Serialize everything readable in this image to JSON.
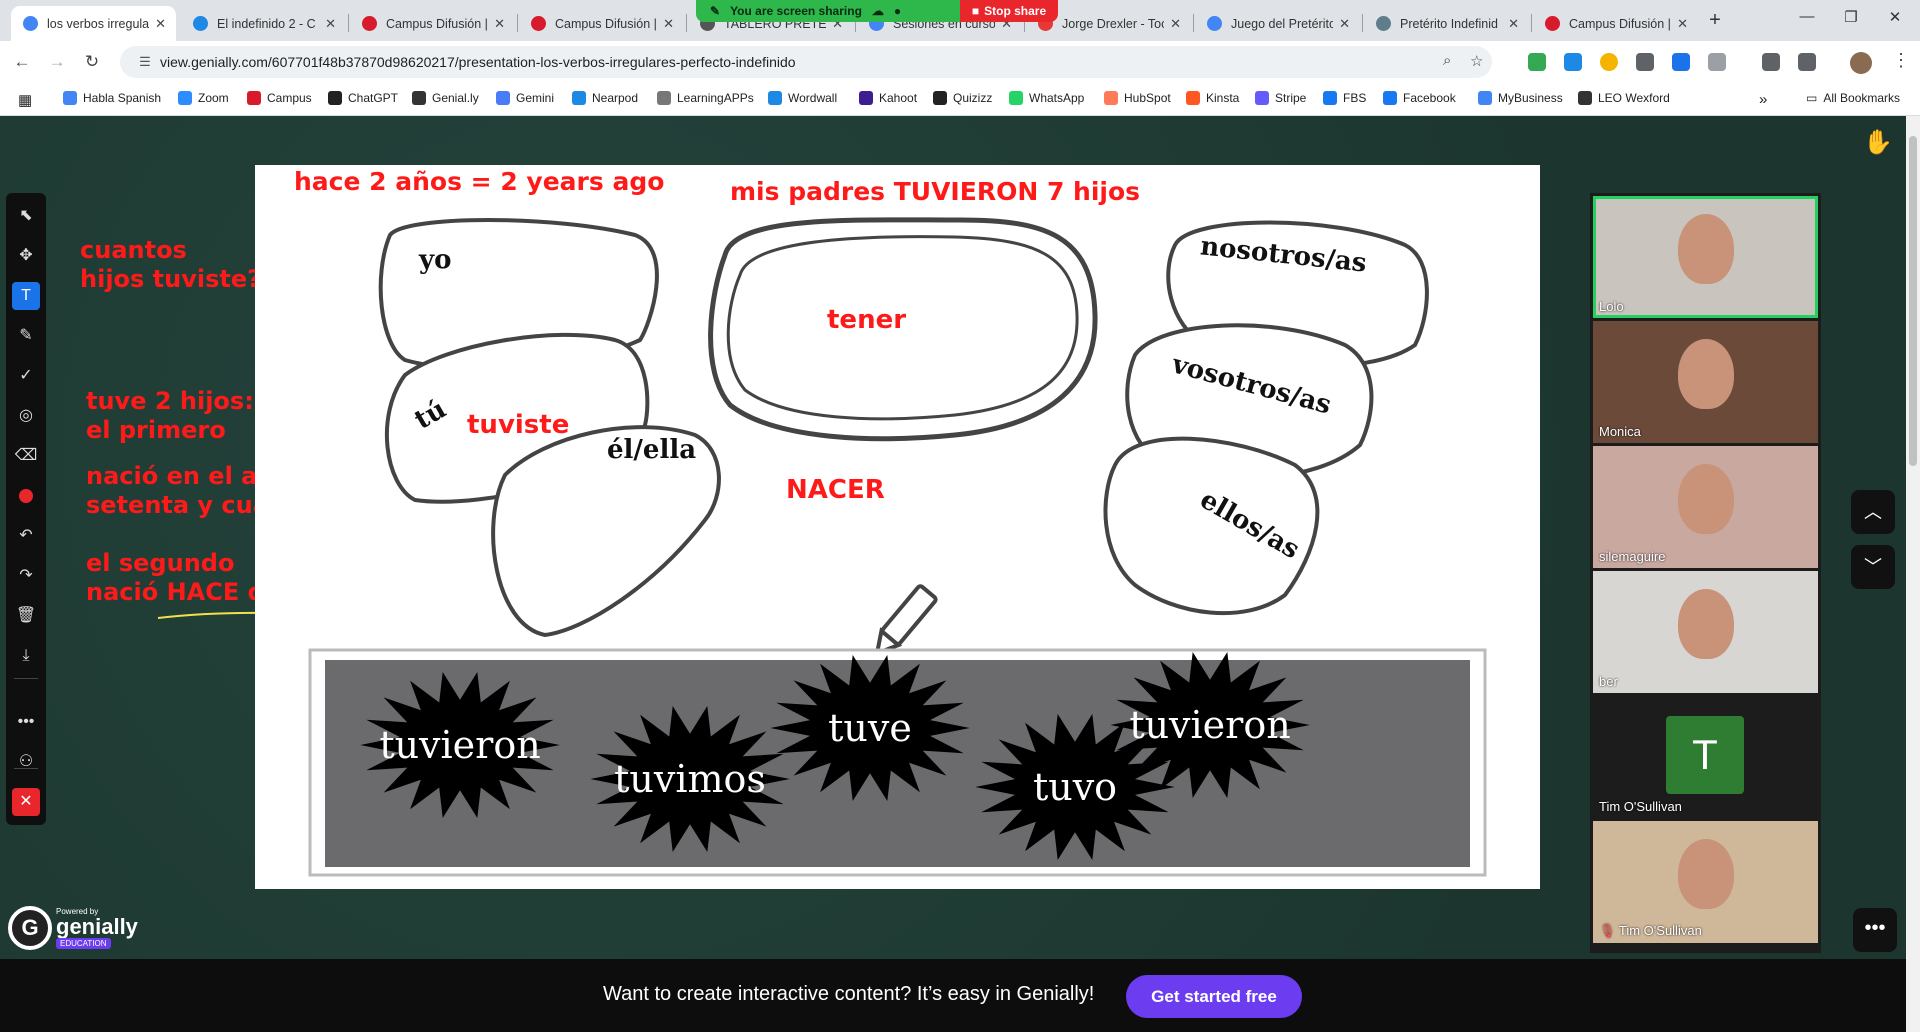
{
  "browser": {
    "tabs": [
      {
        "title": "los verbos irregula",
        "color": "#4285f4",
        "active": true
      },
      {
        "title": "El indefinido 2 - C",
        "color": "#1e88e5"
      },
      {
        "title": "Campus Difusión |",
        "color": "#d81b2c"
      },
      {
        "title": "Campus Difusión |",
        "color": "#d81b2c"
      },
      {
        "title": "TABLERO PRETÉRI",
        "color": "#555555"
      },
      {
        "title": "Sesiones en curso",
        "color": "#4285f4"
      },
      {
        "title": "Jorge Drexler - Toc",
        "color": "#e53935"
      },
      {
        "title": "Juego del Pretérito",
        "color": "#4285f4"
      },
      {
        "title": "Pretérito Indefinid",
        "color": "#607d8b"
      },
      {
        "title": "Campus Difusión |",
        "color": "#d81b2c"
      }
    ],
    "tab_close": "✕",
    "new_tab": "+",
    "window_controls": [
      "—",
      "❐",
      "✕"
    ],
    "share_bar": {
      "status": "You are screen sharing",
      "stop": "Stop share"
    },
    "nav": {
      "back": "←",
      "forward": "→",
      "reload": "↻"
    },
    "url": "view.genially.com/607701f48b37870d98620217/presentation-los-verbos-irregulares-perfecto-indefinido",
    "bookmarks": [
      {
        "label": "Habla Spanish",
        "color": "#4285f4"
      },
      {
        "label": "Zoom",
        "color": "#2d8cff"
      },
      {
        "label": "Campus",
        "color": "#d81b2c"
      },
      {
        "label": "ChatGPT",
        "color": "#222222"
      },
      {
        "label": "Genial.ly",
        "color": "#333333"
      },
      {
        "label": "Gemini",
        "color": "#4a7cf7"
      },
      {
        "label": "Nearpod",
        "color": "#1e88e5"
      },
      {
        "label": "LearningAPPs",
        "color": "#777777"
      },
      {
        "label": "Wordwall",
        "color": "#1e88e5"
      },
      {
        "label": "Kahoot",
        "color": "#3d1e8f"
      },
      {
        "label": "Quizizz",
        "color": "#222222"
      },
      {
        "label": "WhatsApp",
        "color": "#25d366"
      },
      {
        "label": "HubSpot",
        "color": "#ff7a59"
      },
      {
        "label": "Kinsta",
        "color": "#ff5722"
      },
      {
        "label": "Stripe",
        "color": "#635bff"
      },
      {
        "label": "FBS",
        "color": "#1877f2"
      },
      {
        "label": "Facebook",
        "color": "#1877f2"
      },
      {
        "label": "MyBusiness",
        "color": "#4285f4"
      },
      {
        "label": "LEO Wexford",
        "color": "#333333"
      }
    ],
    "bookmarks_more": "»",
    "all_bookmarks": "All Bookmarks"
  },
  "toolbar_icons": [
    "pointer-icon",
    "move-icon",
    "text-icon",
    "pen-icon",
    "check-icon",
    "target-icon",
    "eraser-icon",
    "color-dot",
    "undo-icon",
    "redo-icon",
    "trash-icon",
    "download-icon",
    "more-icon",
    "person-icon",
    "close-icon"
  ],
  "annotations": {
    "left1": "cuantos\nhijos tuviste?",
    "left2": "tuve 2 hijos:\nel primero",
    "left3": "nació en el año\nsetenta y cuatro",
    "left4": "el segundo\nnació HACE dos años",
    "top_left": "hace 2 años = 2 years ago",
    "top_center": "mis padres TUVIERON 7 hijos",
    "in_blob": "tuviste",
    "verb": "tener",
    "nacer": "NACER"
  },
  "slide": {
    "pronouns": {
      "yo": "yo",
      "tu": "tú",
      "el": "él/ella",
      "nosotros": "nosotros/as",
      "vosotros": "vosotros/as",
      "ellos": "ellos/as"
    },
    "bursts": [
      "tuvieron",
      "tuvimos",
      "tuve",
      "tuvo",
      "tuvieron"
    ]
  },
  "participants": [
    {
      "name": "Lolo",
      "speaking": true,
      "bg": "#c9c4bd"
    },
    {
      "name": "Monica",
      "bg": "#6b4a3a"
    },
    {
      "name": "silemaguire",
      "bg": "#c9a8a0"
    },
    {
      "name": "ber",
      "bg": "#d8d6d2"
    },
    {
      "name": "Tim O'Sullivan",
      "avatar": "T",
      "bg": "#1c1c1c"
    },
    {
      "name": "Tim O'Sullivan",
      "bg": "#cfb79a",
      "muted": true
    }
  ],
  "genially": {
    "powered": "Powered by",
    "name": "genially",
    "edition": "EDUCATION"
  },
  "footer": {
    "message": "Want to create interactive content? It’s easy in Genially!",
    "cta": "Get started free"
  }
}
